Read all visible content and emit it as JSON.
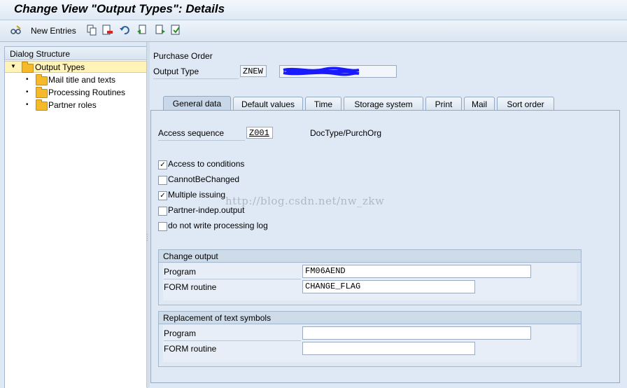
{
  "window": {
    "title": "Change View \"Output Types\": Details"
  },
  "toolbar": {
    "new_entries_label": "New Entries",
    "icons": [
      "edit-glasses-icon",
      "copy-icon",
      "delete-icon",
      "undo-icon",
      "previous-entry-icon",
      "next-entry-icon",
      "select-icon"
    ]
  },
  "tree": {
    "header": "Dialog Structure",
    "root": {
      "label": "Output Types",
      "selected": true,
      "expanded": true
    },
    "children": [
      {
        "label": "Mail title and texts"
      },
      {
        "label": "Processing Routines"
      },
      {
        "label": "Partner roles"
      }
    ]
  },
  "header_fields": {
    "application_label": "Purchase Order",
    "output_type_label": "Output Type",
    "output_type_value": "ZNEW",
    "description_value": ""
  },
  "tabs": [
    {
      "label": "General data",
      "active": true
    },
    {
      "label": "Default values",
      "active": false
    },
    {
      "label": "Time",
      "active": false
    },
    {
      "label": "Storage system",
      "active": false
    },
    {
      "label": "Print",
      "active": false
    },
    {
      "label": "Mail",
      "active": false
    },
    {
      "label": "Sort order",
      "active": false
    }
  ],
  "general": {
    "access_sequence_label": "Access sequence",
    "access_sequence_value": "Z001",
    "access_sequence_desc": "DocType/PurchOrg",
    "checkboxes": [
      {
        "label": "Access to conditions",
        "checked": true
      },
      {
        "label": "CannotBeChanged",
        "checked": false
      },
      {
        "label": "Multiple issuing",
        "checked": true
      },
      {
        "label": "Partner-indep.output",
        "checked": false
      },
      {
        "label": "do not write processing log",
        "checked": false
      }
    ]
  },
  "change_output": {
    "title": "Change output",
    "program_label": "Program",
    "program_value": "FM06AEND",
    "form_label": "FORM routine",
    "form_value": "CHANGE_FLAG"
  },
  "replacement": {
    "title": "Replacement of text symbols",
    "program_label": "Program",
    "program_value": "",
    "form_label": "FORM routine",
    "form_value": ""
  },
  "watermark": "http://blog.csdn.net/nw_zkw",
  "colors": {
    "background": "#dfe9f5",
    "selection": "#fff3b8",
    "redaction": "#1a1aff"
  }
}
